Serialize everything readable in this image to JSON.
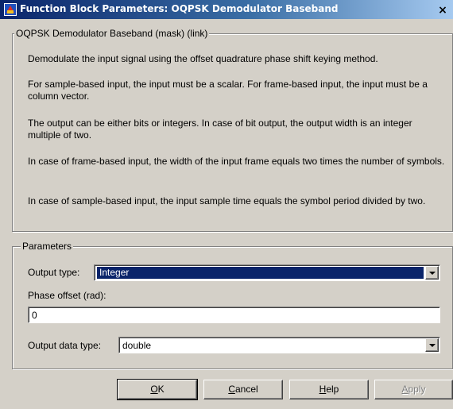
{
  "window": {
    "title": "Function Block Parameters: OQPSK Demodulator Baseband",
    "close_glyph": "×",
    "icon": "simulink-block-icon"
  },
  "description_group": {
    "legend": "OQPSK Demodulator Baseband (mask) (link)",
    "paragraphs": [
      "Demodulate the input signal using the offset quadrature phase shift keying method.",
      "For sample-based input, the input must be a scalar. For frame-based input, the input must be a column vector.",
      "The output can be either bits or integers. In case of bit output, the output width is an integer multiple of two.",
      "In case of frame-based input, the width of the input frame equals two times the number of symbols.",
      "In case of sample-based input, the input sample time equals the symbol period divided by two."
    ]
  },
  "parameters_group": {
    "legend": "Parameters",
    "output_type": {
      "label": "Output type:",
      "value": "Integer"
    },
    "phase_offset": {
      "label": "Phase offset (rad):",
      "value": "0"
    },
    "output_data_type": {
      "label": "Output data type:",
      "value": "double"
    }
  },
  "buttons": {
    "ok": {
      "mnemonic": "O",
      "rest": "K"
    },
    "cancel": {
      "mnemonic": "C",
      "rest": "ancel"
    },
    "help": {
      "mnemonic": "H",
      "rest": "elp"
    },
    "apply": {
      "mnemonic": "A",
      "rest": "pply"
    }
  }
}
